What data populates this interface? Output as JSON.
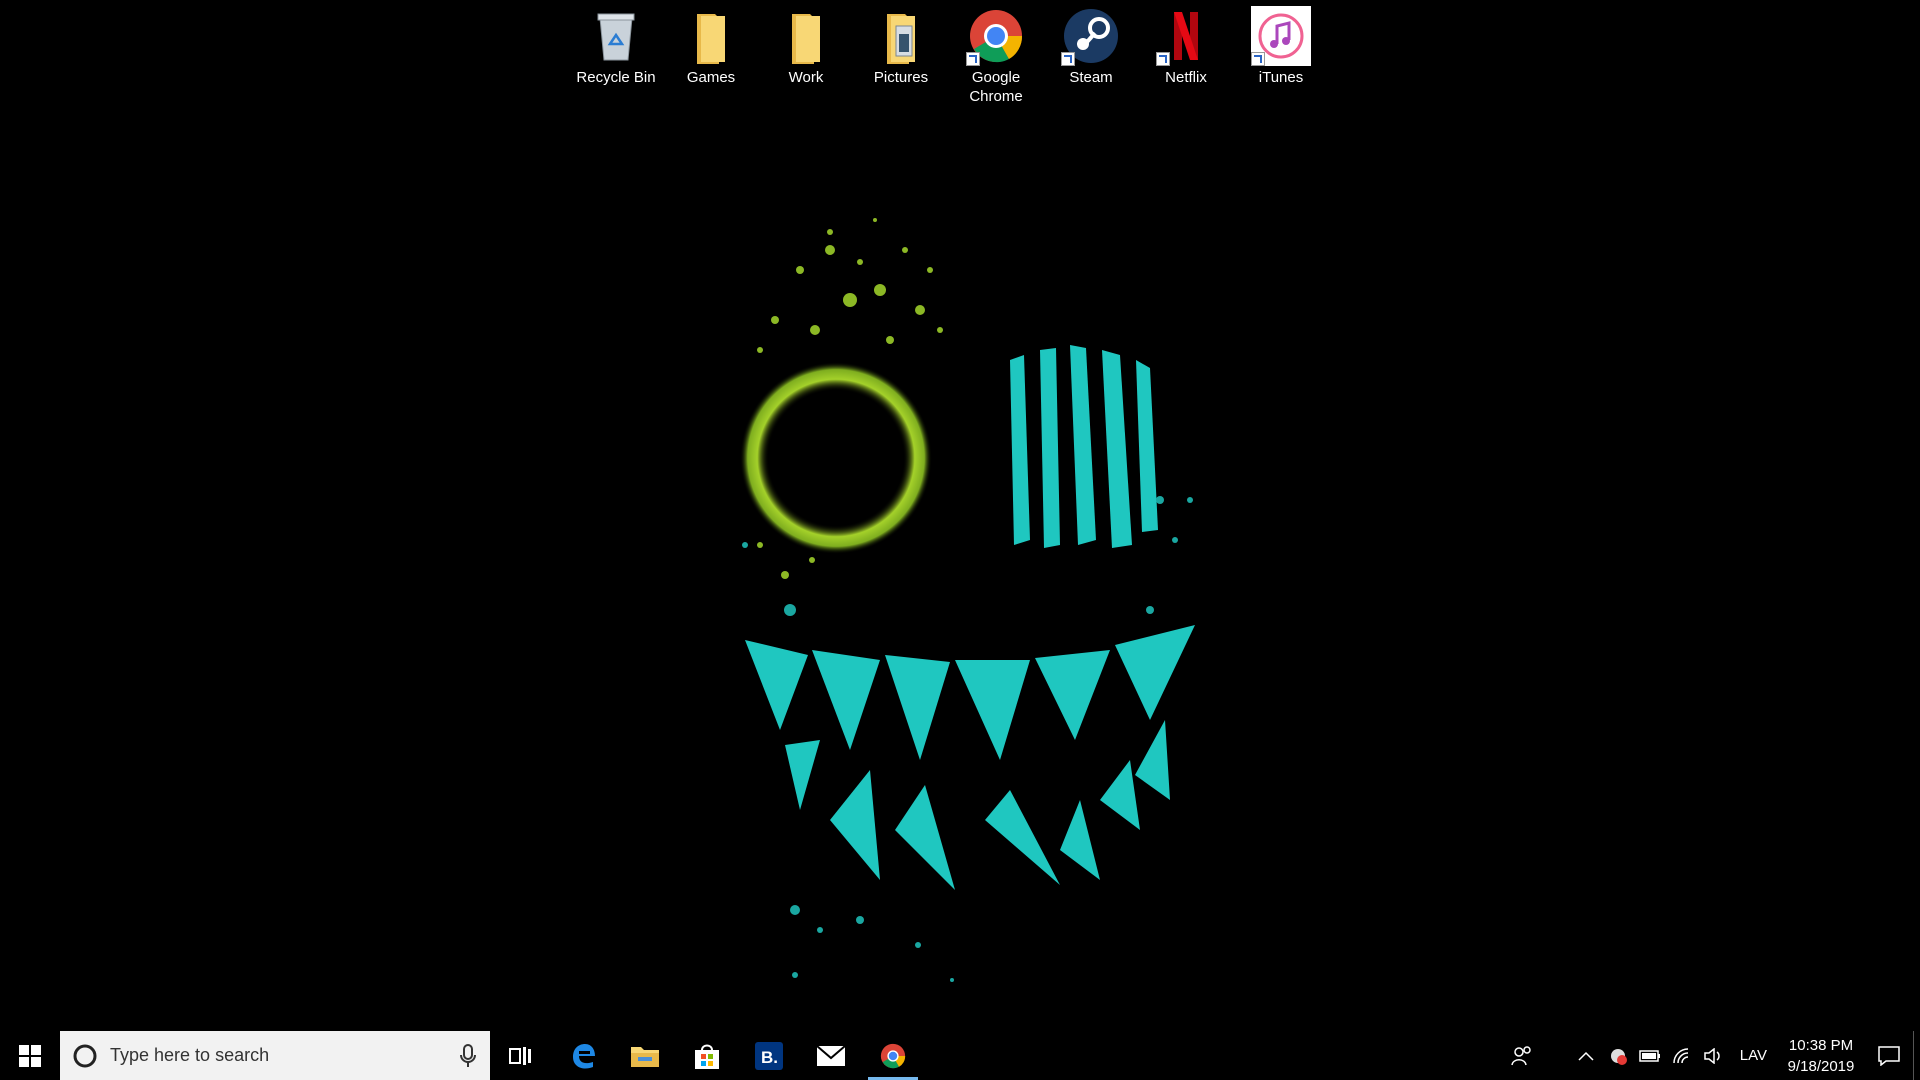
{
  "desktop": {
    "icons": [
      {
        "label": "Recycle Bin",
        "icon": "recycle-bin-icon"
      },
      {
        "label": "Games",
        "icon": "folder-icon"
      },
      {
        "label": "Work",
        "icon": "folder-icon"
      },
      {
        "label": "Pictures",
        "icon": "pictures-folder-icon"
      },
      {
        "label": "Google Chrome",
        "icon": "chrome-icon"
      },
      {
        "label": "Steam",
        "icon": "steam-icon"
      },
      {
        "label": "Netflix",
        "icon": "netflix-icon"
      },
      {
        "label": "iTunes",
        "icon": "itunes-icon"
      }
    ],
    "wallpaper": "grinning-face-wallpaper",
    "colors": {
      "eye_green": "#a4d12a",
      "teal": "#1fc7c0"
    }
  },
  "taskbar": {
    "search": {
      "placeholder": "Type here to search"
    },
    "pinned": [
      {
        "name": "task-view",
        "icon": "task-view-icon"
      },
      {
        "name": "edge",
        "icon": "edge-icon"
      },
      {
        "name": "file-explorer",
        "icon": "folder-icon"
      },
      {
        "name": "store",
        "icon": "store-icon"
      },
      {
        "name": "booking",
        "icon": "booking-icon",
        "text": "B."
      },
      {
        "name": "mail",
        "icon": "mail-icon"
      },
      {
        "name": "chrome",
        "icon": "chrome-icon",
        "active": true
      }
    ],
    "tray": {
      "language": "LAV",
      "time": "10:38 PM",
      "date": "9/18/2019",
      "accent": "#76b9ed"
    }
  }
}
